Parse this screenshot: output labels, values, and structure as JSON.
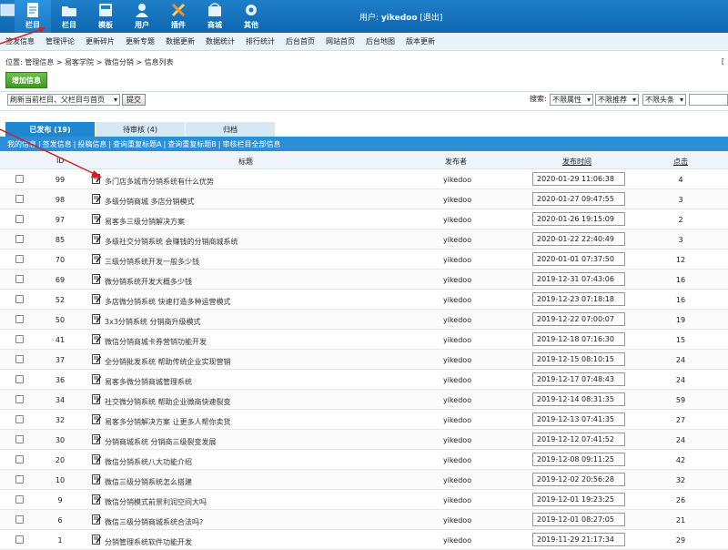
{
  "topnav": [
    {
      "label": "",
      "icon": "frame-icon"
    },
    {
      "label": "栏目",
      "icon": "document-icon"
    },
    {
      "label": "栏目",
      "icon": "folder-icon"
    },
    {
      "label": "模板",
      "icon": "template-icon"
    },
    {
      "label": "用户",
      "icon": "user-icon"
    },
    {
      "label": "插件",
      "icon": "tools-icon"
    },
    {
      "label": "商城",
      "icon": "shop-icon"
    },
    {
      "label": "其他",
      "icon": "gear-icon"
    }
  ],
  "user": {
    "prefix": "用户:",
    "name": "yikedoo",
    "logout": "[退出]"
  },
  "subnav": [
    "签发信息",
    "管理评论",
    "更新碎片",
    "更新专题",
    "数据更新",
    "数据统计",
    "排行统计",
    "后台首页",
    "网站首页",
    "后台地图",
    "版本更新"
  ],
  "breadcrumb": "位置: 管理信息 > 易客学院 > 微信分销 > 信息列表",
  "right_mark": "[",
  "add_button": "增加信息",
  "filter": {
    "refresh_select": "刷新当前栏目、父栏目与首页",
    "submit": "提交",
    "search_label": "搜索:",
    "attr_select": "不限属性",
    "recommend_select": "不限推荐",
    "headline_select": "不限头条"
  },
  "tabs": [
    {
      "label": "已发布 (19)",
      "active": true
    },
    {
      "label": "待审核 (4)",
      "active": false
    },
    {
      "label": "归档",
      "active": false
    }
  ],
  "links": [
    "我的信息",
    "签发信息",
    "投稿信息",
    "查询重复标题A",
    "查询重复标题B",
    "审核栏目全部信息"
  ],
  "table": {
    "headers": {
      "id": "ID",
      "title": "标题",
      "publisher": "发布者",
      "time": "发布时间",
      "clicks": "点击"
    },
    "rows": [
      {
        "id": "99",
        "title": "多门店多城市分销系统有什么优势",
        "publisher": "yikedoo",
        "time": "2020-01-29 11:06:38",
        "clicks": "4"
      },
      {
        "id": "98",
        "title": "多级分销商城 多店分销模式",
        "publisher": "yikedoo",
        "time": "2020-01-27 09:47:55",
        "clicks": "3"
      },
      {
        "id": "97",
        "title": "易客多三级分销解决方案",
        "publisher": "yikedoo",
        "time": "2020-01-26 19:15:09",
        "clicks": "2"
      },
      {
        "id": "85",
        "title": "多级社交分销系统 会赚钱的分销商城系统",
        "publisher": "yikedoo",
        "time": "2020-01-22 22:40:49",
        "clicks": "3"
      },
      {
        "id": "70",
        "title": "三级分销系统开发一般多少钱",
        "publisher": "yikedoo",
        "time": "2020-01-01 07:37:50",
        "clicks": "12"
      },
      {
        "id": "69",
        "title": "微分销系统开发大概多少钱",
        "publisher": "yikedoo",
        "time": "2019-12-31 07:43:06",
        "clicks": "16"
      },
      {
        "id": "52",
        "title": "多店微分销系统 快速打造多种运营模式",
        "publisher": "yikedoo",
        "time": "2019-12-23 07:18:18",
        "clicks": "16"
      },
      {
        "id": "50",
        "title": "3x3分销系统 分销商升级模式",
        "publisher": "yikedoo",
        "time": "2019-12-22 07:00:07",
        "clicks": "19"
      },
      {
        "id": "41",
        "title": "微信分销商城卡券营销功能开发",
        "publisher": "yikedoo",
        "time": "2019-12-18 07:16:30",
        "clicks": "15"
      },
      {
        "id": "37",
        "title": "全分销批发系统 帮助传统企业实现营销",
        "publisher": "yikedoo",
        "time": "2019-12-15 08:10:15",
        "clicks": "24"
      },
      {
        "id": "36",
        "title": "易客多微分销商城管理系统",
        "publisher": "yikedoo",
        "time": "2019-12-17 07:48:43",
        "clicks": "24"
      },
      {
        "id": "34",
        "title": "社交微分销系统 帮助企业微商快速裂变",
        "publisher": "yikedoo",
        "time": "2019-12-14 08:31:35",
        "clicks": "59"
      },
      {
        "id": "32",
        "title": "易客多分销解决方案 让更多人帮你卖货",
        "publisher": "yikedoo",
        "time": "2019-12-13 07:41:35",
        "clicks": "27"
      },
      {
        "id": "30",
        "title": "分销商城系统 分销商三级裂变发展",
        "publisher": "yikedoo",
        "time": "2019-12-12 07:41:52",
        "clicks": "24"
      },
      {
        "id": "20",
        "title": "微信分销系统八大功能介绍",
        "publisher": "yikedoo",
        "time": "2019-12-08 09:11:25",
        "clicks": "42"
      },
      {
        "id": "10",
        "title": "微信三级分销系统怎么搭建",
        "publisher": "yikedoo",
        "time": "2019-12-02 20:56:28",
        "clicks": "32"
      },
      {
        "id": "9",
        "title": "微信分销模式前景利润空间大吗",
        "publisher": "yikedoo",
        "time": "2019-12-01 19:23:25",
        "clicks": "26"
      },
      {
        "id": "6",
        "title": "微信三级分销商城系统合法吗?",
        "publisher": "yikedoo",
        "time": "2019-12-01 08:27:05",
        "clicks": "21"
      },
      {
        "id": "1",
        "title": "分销管理系统软件功能开发",
        "publisher": "yikedoo",
        "time": "2019-11-29 21:17:34",
        "clicks": "29"
      }
    ]
  },
  "colors": {
    "topbar": "#1577c0",
    "accent": "#2b8ed6",
    "add_button": "#4aa82c",
    "arrow": "#d42020"
  }
}
